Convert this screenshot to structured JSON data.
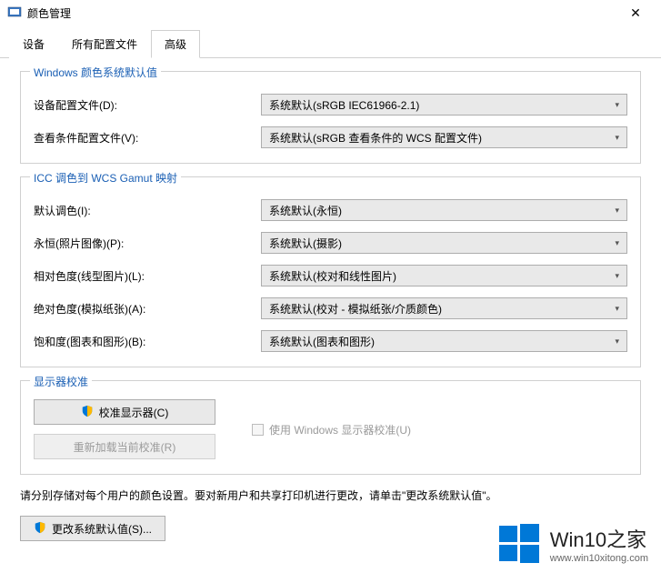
{
  "window": {
    "title": "颜色管理"
  },
  "tabs": {
    "device": "设备",
    "all_profiles": "所有配置文件",
    "advanced": "高级"
  },
  "group_defaults": {
    "title": "Windows 颜色系统默认值",
    "rows": {
      "device_profile": {
        "label": "设备配置文件(D):",
        "value": "系统默认(sRGB IEC61966-2.1)"
      },
      "viewing_profile": {
        "label": "查看条件配置文件(V):",
        "value": "系统默认(sRGB 查看条件的 WCS 配置文件)"
      }
    }
  },
  "group_gamut": {
    "title": "ICC 调色到 WCS Gamut 映射",
    "rows": {
      "default": {
        "label": "默认调色(I):",
        "value": "系统默认(永恒)"
      },
      "perceptual": {
        "label": "永恒(照片图像)(P):",
        "value": "系统默认(摄影)"
      },
      "relative": {
        "label": "相对色度(线型图片)(L):",
        "value": "系统默认(校对和线性图片)"
      },
      "absolute": {
        "label": "绝对色度(模拟纸张)(A):",
        "value": "系统默认(校对 - 模拟纸张/介质颜色)"
      },
      "saturation": {
        "label": "饱和度(图表和图形)(B):",
        "value": "系统默认(图表和图形)"
      }
    }
  },
  "group_calib": {
    "title": "显示器校准",
    "calibrate_btn": "校准显示器(C)",
    "reload_btn": "重新加载当前校准(R)",
    "use_calib_checkbox": "使用 Windows 显示器校准(U)"
  },
  "info_text": "请分别存储对每个用户的颜色设置。要对新用户和共享打印机进行更改，请单击\"更改系统默认值\"。",
  "change_defaults_btn": "更改系统默认值(S)...",
  "watermark": {
    "title": "Win10之家",
    "url": "www.win10xitong.com"
  }
}
